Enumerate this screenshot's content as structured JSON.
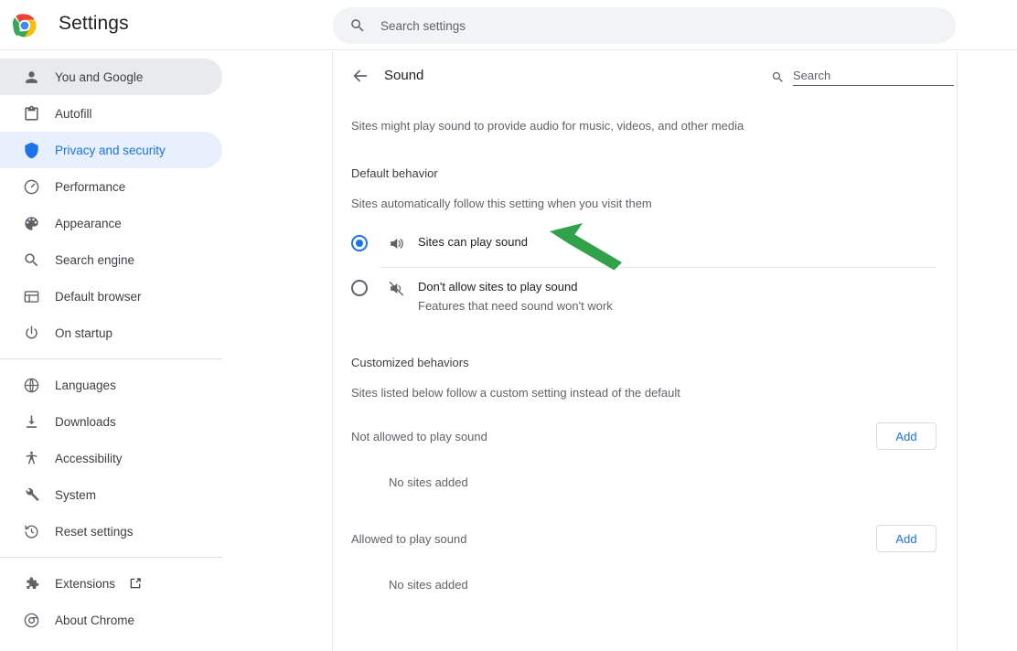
{
  "app": {
    "title": "Settings",
    "logo_icon": "chrome-logo"
  },
  "search": {
    "placeholder": "Search settings",
    "value": "",
    "icon": "search-icon"
  },
  "sidebar": {
    "groups": [
      {
        "items": [
          {
            "label": "You and Google",
            "icon": "person-icon",
            "state": "hovered"
          },
          {
            "label": "Autofill",
            "icon": "clipboard-icon",
            "state": "normal"
          },
          {
            "label": "Privacy and security",
            "icon": "shield-icon",
            "state": "selected"
          },
          {
            "label": "Performance",
            "icon": "speedometer-icon",
            "state": "normal"
          },
          {
            "label": "Appearance",
            "icon": "palette-icon",
            "state": "normal"
          },
          {
            "label": "Search engine",
            "icon": "search-icon",
            "state": "normal"
          },
          {
            "label": "Default browser",
            "icon": "browser-window-icon",
            "state": "normal"
          },
          {
            "label": "On startup",
            "icon": "power-icon",
            "state": "normal"
          }
        ]
      },
      {
        "items": [
          {
            "label": "Languages",
            "icon": "globe-icon",
            "state": "normal"
          },
          {
            "label": "Downloads",
            "icon": "download-icon",
            "state": "normal"
          },
          {
            "label": "Accessibility",
            "icon": "accessibility-icon",
            "state": "normal"
          },
          {
            "label": "System",
            "icon": "wrench-icon",
            "state": "normal"
          },
          {
            "label": "Reset settings",
            "icon": "history-restore-icon",
            "state": "normal"
          }
        ]
      },
      {
        "items": [
          {
            "label": "Extensions",
            "icon": "puzzle-icon",
            "state": "normal",
            "external": true
          },
          {
            "label": "About Chrome",
            "icon": "chrome-outline-icon",
            "state": "normal"
          }
        ]
      }
    ]
  },
  "main": {
    "back_icon": "back-arrow-icon",
    "title": "Sound",
    "search": {
      "placeholder": "Search",
      "value": "",
      "icon": "search-icon"
    },
    "description": "Sites might play sound to provide audio for music, videos, and other media",
    "default_behavior": {
      "title": "Default behavior",
      "subtitle": "Sites automatically follow this setting when you visit them",
      "options": [
        {
          "label": "Sites can play sound",
          "sublabel": "",
          "icon": "volume-up-icon",
          "selected": true
        },
        {
          "label": "Don't allow sites to play sound",
          "sublabel": "Features that need sound won't work",
          "icon": "volume-mute-icon",
          "selected": false
        }
      ]
    },
    "customized_behaviors": {
      "title": "Customized behaviors",
      "subtitle": "Sites listed below follow a custom setting instead of the default",
      "lists": [
        {
          "label": "Not allowed to play sound",
          "add_label": "Add",
          "empty_text": "No sites added"
        },
        {
          "label": "Allowed to play sound",
          "add_label": "Add",
          "empty_text": "No sites added"
        }
      ]
    }
  },
  "annotation": {
    "arrow_icon": "green-pointer-arrow",
    "color": "#2fa24a"
  },
  "colors": {
    "accent_blue": "#1a73e8",
    "selected_pill": "#e8f0fe",
    "hover_pill": "#e8eaed",
    "text_primary": "#202124",
    "text_secondary": "#5f6368",
    "annotation_green": "#2fa24a"
  }
}
